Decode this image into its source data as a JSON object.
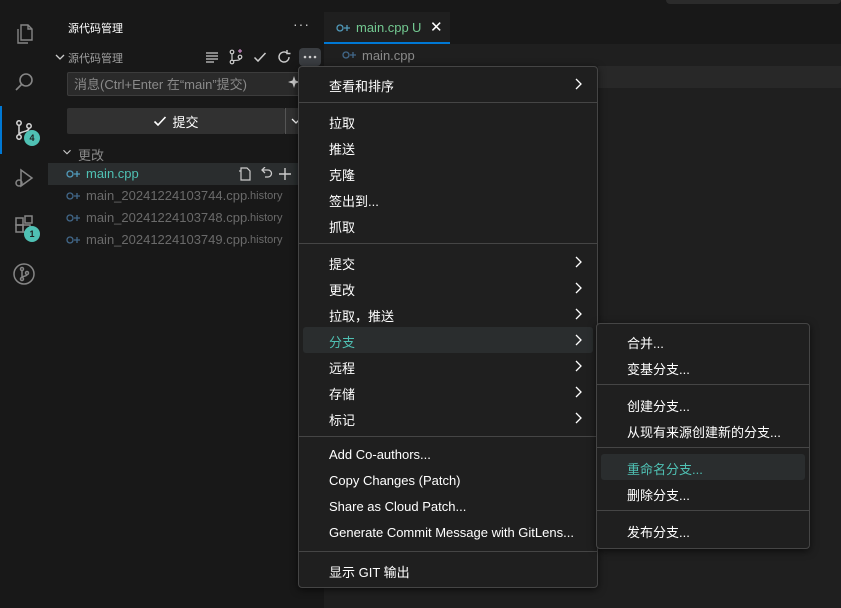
{
  "sidebar": {
    "title": "源代码管理",
    "section_label": "源代码管理",
    "commit_placeholder": "消息(Ctrl+Enter 在“main”提交)",
    "commit_label": "提交",
    "changes_label": "更改",
    "files": [
      {
        "name": "main.cpp",
        "desc": "",
        "color": "#4fc1b4"
      },
      {
        "name": "main_20241224103744.cpp",
        "desc": ".history",
        "color": "#6a6a6a"
      },
      {
        "name": "main_20241224103748.cpp",
        "desc": ".history",
        "color": "#6a6a6a"
      },
      {
        "name": "main_20241224103749.cpp",
        "desc": ".history",
        "color": "#6a6a6a"
      }
    ]
  },
  "activity": {
    "scm_badge": "4",
    "extensions_badge": "1"
  },
  "editor": {
    "tab_label": "main.cpp",
    "tab_status": "U",
    "breadcrumb": "main.cpp"
  },
  "menu": {
    "items": [
      {
        "label": "查看和排序",
        "submenu": true
      },
      {
        "label": "拉取"
      },
      {
        "label": "推送"
      },
      {
        "label": "克隆"
      },
      {
        "label": "签出到..."
      },
      {
        "label": "抓取"
      },
      {
        "label": "提交",
        "submenu": true
      },
      {
        "label": "更改",
        "submenu": true
      },
      {
        "label": "拉取，推送",
        "submenu": true
      },
      {
        "label": "分支",
        "submenu": true
      },
      {
        "label": "远程",
        "submenu": true
      },
      {
        "label": "存储",
        "submenu": true
      },
      {
        "label": "标记",
        "submenu": true
      },
      {
        "label": "Add Co-authors..."
      },
      {
        "label": "Copy Changes (Patch)"
      },
      {
        "label": "Share as Cloud Patch..."
      },
      {
        "label": "Generate Commit Message with GitLens..."
      },
      {
        "label": "显示 GIT 输出"
      }
    ]
  },
  "submenu": {
    "items": [
      {
        "label": "合并..."
      },
      {
        "label": "变基分支..."
      },
      {
        "label": "创建分支..."
      },
      {
        "label": "从现有来源创建新的分支..."
      },
      {
        "label": "重命名分支..."
      },
      {
        "label": "删除分支..."
      },
      {
        "label": "发布分支..."
      }
    ]
  },
  "colors": {
    "accent": "#4fc1b4",
    "untracked": "#73c991",
    "menu_bg": "#1f1f1f"
  }
}
